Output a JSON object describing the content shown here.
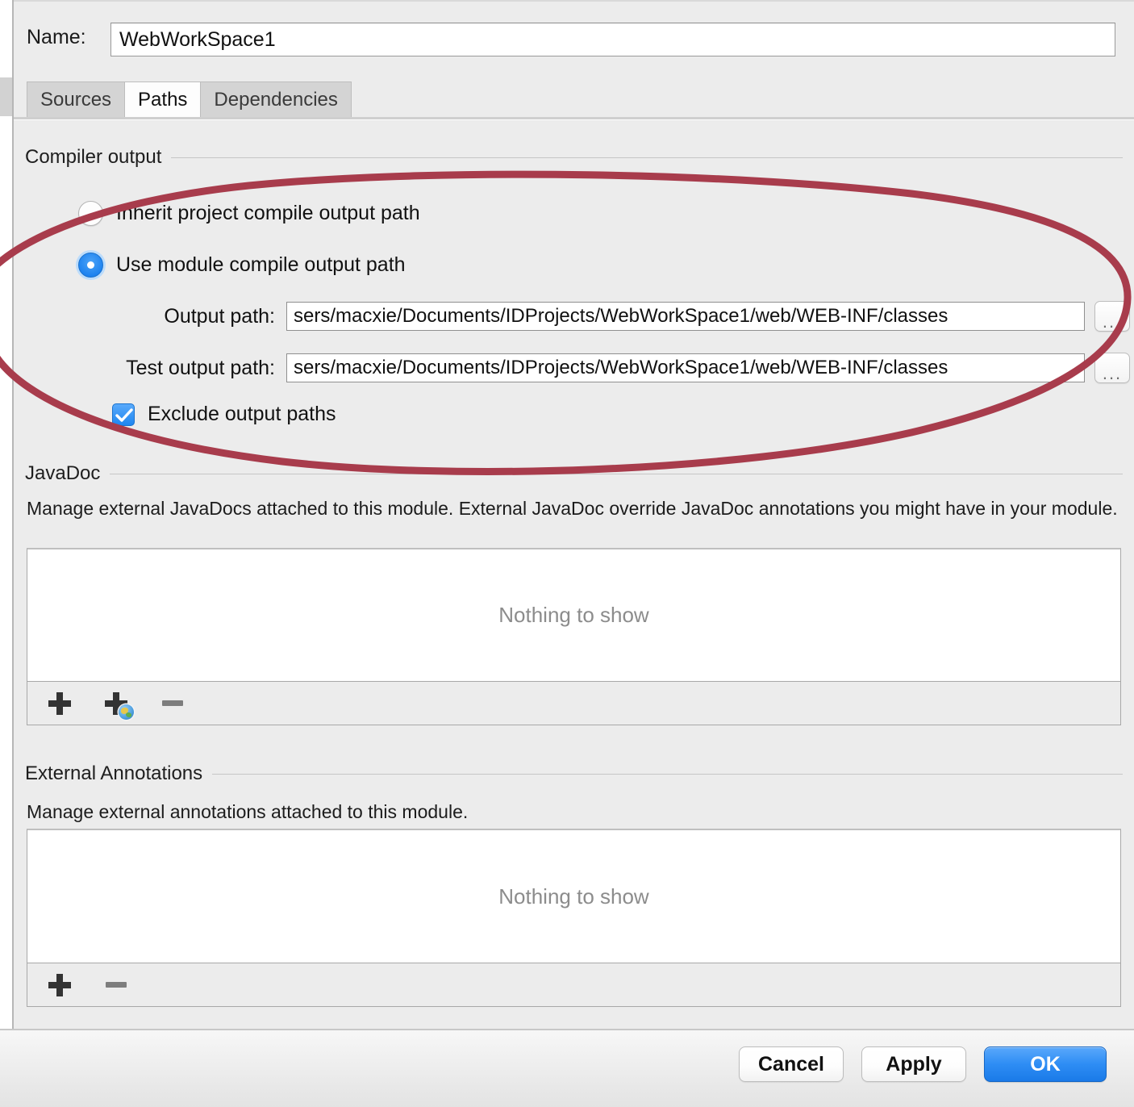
{
  "window": {
    "name_label": "Name:",
    "module_name": "WebWorkSpace1",
    "name_placeholder": "Module name"
  },
  "tabs": [
    {
      "label": "Sources",
      "active": false
    },
    {
      "label": "Paths",
      "active": true
    },
    {
      "label": "Dependencies",
      "active": false
    }
  ],
  "compiler_output": {
    "section_title": "Compiler output",
    "options": [
      {
        "label": "Inherit project compile output path",
        "selected": false
      },
      {
        "label": "Use module compile output path",
        "selected": true
      }
    ],
    "output_path": {
      "label": "Output path:",
      "value": "sers/macxie/Documents/IDProjects/WebWorkSpace1/web/WEB-INF/classes",
      "placeholder": "Output path",
      "browse_label": "..."
    },
    "test_output_path": {
      "label": "Test output path:",
      "value": "sers/macxie/Documents/IDProjects/WebWorkSpace1/web/WEB-INF/classes",
      "placeholder": "Test output path",
      "browse_label": "..."
    },
    "exclude_output_paths": {
      "label": "Exclude output paths",
      "checked": true
    }
  },
  "javadoc": {
    "section_title": "JavaDoc",
    "description": "Manage external JavaDocs attached to this module. External JavaDoc override JavaDoc annotations you might have in your module.",
    "empty_text": "Nothing to show",
    "toolbar": [
      {
        "name": "add",
        "label": "+"
      },
      {
        "name": "add-url",
        "label": "+"
      },
      {
        "name": "remove",
        "label": "−"
      }
    ]
  },
  "external_annotations": {
    "section_title": "External Annotations",
    "description": "Manage external annotations attached to this module.",
    "empty_text": "Nothing to show",
    "toolbar": [
      {
        "name": "add",
        "label": "+"
      },
      {
        "name": "remove",
        "label": "−"
      }
    ]
  },
  "footer": {
    "cancel_label": "Cancel",
    "apply_label": "Apply",
    "ok_label": "OK"
  },
  "colors": {
    "accent_blue": "#1f86f0",
    "ok_button": "#2e8df4",
    "annotation_red": "#a83c4c",
    "panel_bg": "#ececec",
    "empty_text": "#8c8c8c"
  },
  "annotation": {
    "shape": "ellipse",
    "note": "hand-drawn red ellipse highlighting the Compiler output section"
  }
}
